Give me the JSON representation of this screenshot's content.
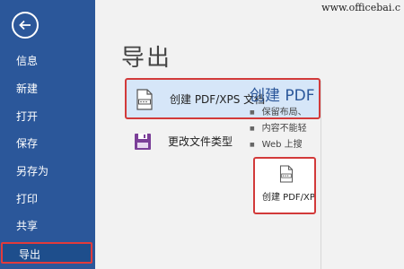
{
  "watermark": "www.officebai.c",
  "sidebar": {
    "items": [
      {
        "label": "信息"
      },
      {
        "label": "新建"
      },
      {
        "label": "打开"
      },
      {
        "label": "保存"
      },
      {
        "label": "另存为"
      },
      {
        "label": "打印"
      },
      {
        "label": "共享"
      },
      {
        "label": "导出"
      }
    ],
    "active": "导出"
  },
  "main": {
    "title": "导出",
    "options": [
      {
        "label": "创建 PDF/XPS 文档",
        "icon": "pdf-document-icon"
      },
      {
        "label": "更改文件类型",
        "icon": "save-file-type-icon"
      }
    ]
  },
  "right": {
    "title": "创建 PDF",
    "bullets": [
      "保留布局、",
      "内容不能轻",
      "Web 上搜"
    ],
    "button_label": "创建 PDF/XPS"
  },
  "colors": {
    "sidebar_bg": "#2b579a",
    "highlight_border": "#d23a3a",
    "selected_bg": "#d6e6f8"
  }
}
